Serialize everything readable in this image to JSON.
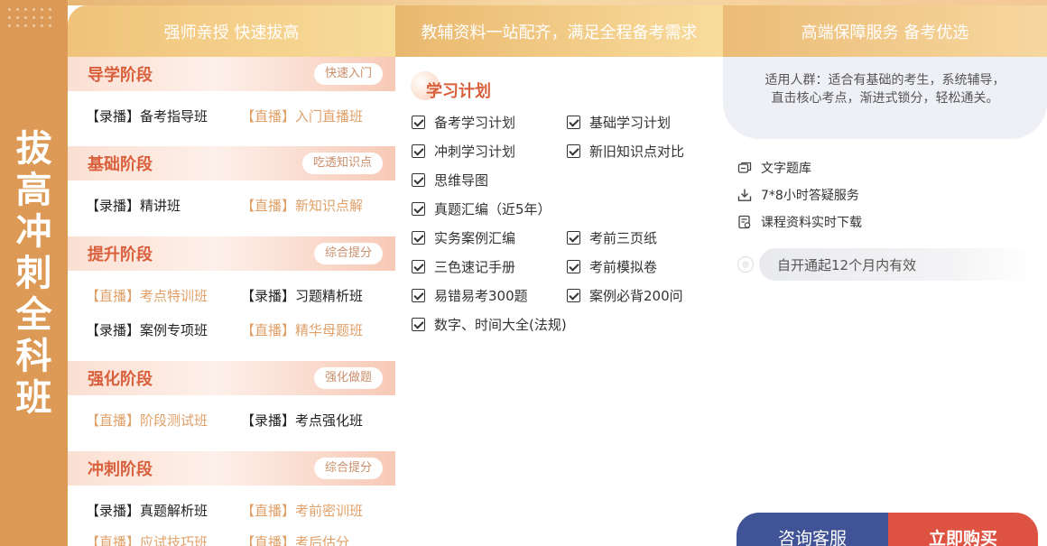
{
  "side_title": "拔高冲刺全科班",
  "headers": {
    "col1": "强师亲授 快速拔高",
    "col2": "教辅资料一站配齐，满足全程备考需求",
    "col3": "高端保障服务 备考优选"
  },
  "stages": [
    {
      "name": "导学阶段",
      "tag": "快速入门",
      "courses": [
        {
          "label": "【录播】备考指导班",
          "type": "rec"
        },
        {
          "label": "【直播】入门直播班",
          "type": "live"
        }
      ]
    },
    {
      "name": "基础阶段",
      "tag": "吃透知识点",
      "courses": [
        {
          "label": "【录播】精讲班",
          "type": "rec"
        },
        {
          "label": "【直播】新知识点解",
          "type": "live"
        }
      ]
    },
    {
      "name": "提升阶段",
      "tag": "综合提分",
      "courses": [
        {
          "label": "【直播】考点特训班",
          "type": "live"
        },
        {
          "label": "【录播】习题精析班",
          "type": "rec"
        },
        {
          "label": "【录播】案例专项班",
          "type": "rec"
        },
        {
          "label": "【直播】精华母题班",
          "type": "live"
        }
      ]
    },
    {
      "name": "强化阶段",
      "tag": "强化做题",
      "courses": [
        {
          "label": "【直播】阶段测试班",
          "type": "live"
        },
        {
          "label": "【录播】考点强化班",
          "type": "rec"
        }
      ]
    },
    {
      "name": "冲刺阶段",
      "tag": "综合提分",
      "courses": [
        {
          "label": "【录播】真题解析班",
          "type": "rec"
        },
        {
          "label": "【直播】考前密训班",
          "type": "live"
        },
        {
          "label": "【直播】应试技巧班",
          "type": "live"
        },
        {
          "label": "【直播】考后估分",
          "type": "live"
        }
      ]
    }
  ],
  "plan": {
    "title": "学习计划",
    "items": [
      "备考学习计划",
      "基础学习计划",
      "冲刺学习计划",
      "新旧知识点对比",
      "思维导图",
      "真题汇编（近5年）",
      "实务案例汇编",
      "考前三页纸",
      "三色速记手册",
      "考前模拟卷",
      "易错易考300题",
      "案例必背200问",
      "数字、时间大全(法规)"
    ]
  },
  "service": {
    "audience": "适用人群：适合有基础的考生，系统辅导，直击核心考点，渐进式锁分，轻松通关。",
    "items": [
      {
        "label": "文字题库",
        "icon": "question-bank-icon"
      },
      {
        "label": "7*8小时答疑服务",
        "icon": "download-qa-icon"
      },
      {
        "label": "课程资料实时下载",
        "icon": "document-download-icon"
      }
    ],
    "validity": "自开通起12个月内有效"
  },
  "buttons": {
    "consult": "咨询客服",
    "buy": "立即购买"
  },
  "colors": {
    "side": "#dc9a56",
    "stage_title": "#d9603c",
    "live_text": "#e0a068",
    "consult_btn": "#3f5396",
    "buy_btn": "#dd5240"
  }
}
